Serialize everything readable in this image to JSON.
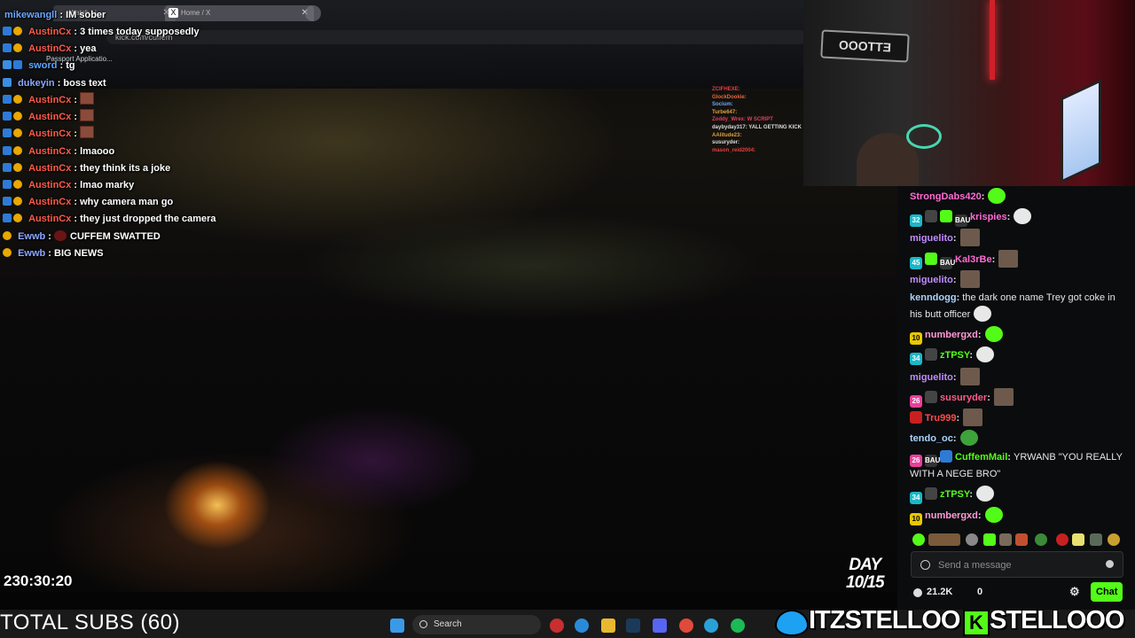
{
  "browser": {
    "tab1_label": "Watch Li",
    "tab2_label": "Home / X",
    "address": "kick.com/cuffem",
    "bookmark": "Passport Applicatio..."
  },
  "overlay_chat": [
    {
      "user": "mikewangll",
      "color": "#6aa8ff",
      "message": "IM sober"
    },
    {
      "user": "AustinCx",
      "color": "#ff5a4a",
      "message": "3 times today supposedly"
    },
    {
      "user": "AustinCx",
      "color": "#ff5a4a",
      "message": "yea"
    },
    {
      "user": "sword",
      "color": "#5aa8ff",
      "message": "tg"
    },
    {
      "user": "dukeyin",
      "color": "#8aa8ff",
      "message": "boss text"
    },
    {
      "user": "AustinCx",
      "color": "#ff5a4a",
      "message": ""
    },
    {
      "user": "AustinCx",
      "color": "#ff5a4a",
      "message": ""
    },
    {
      "user": "AustinCx",
      "color": "#ff5a4a",
      "message": ""
    },
    {
      "user": "AustinCx",
      "color": "#ff5a4a",
      "message": "lmaooo"
    },
    {
      "user": "AustinCx",
      "color": "#ff5a4a",
      "message": "they think its a joke"
    },
    {
      "user": "AustinCx",
      "color": "#ff5a4a",
      "message": "lmao marky"
    },
    {
      "user": "AustinCx",
      "color": "#ff5a4a",
      "message": "why camera man go"
    },
    {
      "user": "AustinCx",
      "color": "#ff5a4a",
      "message": "they just dropped the camera"
    },
    {
      "user": "Ewwb",
      "color": "#8aa8ff",
      "message": "CUFFEM SWATTED"
    },
    {
      "user": "Ewwb",
      "color": "#8aa8ff",
      "message": "BIG NEWS"
    }
  ],
  "mini_chat": [
    "ZCIFHEXE:",
    "GlockDookie:",
    "Socium:",
    "Turbe647:",
    "Zoddy_Wrex: W SCRIPT",
    "daybyday317: YALL GETTING KICK",
    "AAlitude23:",
    "susuryder:",
    "mason_reid2004:"
  ],
  "stream_timer": "230:30:20",
  "day_counter": {
    "line1": "DAY",
    "line2": "10/15"
  },
  "chat": {
    "messages": [
      {
        "user": "StrongDabs420",
        "color": "#ff6ad5",
        "badges": [],
        "text": "",
        "emote": "green"
      },
      {
        "user": "krispies",
        "color": "#ff6ad5",
        "badges": [
          "32",
          "",
          "",
          "BAU"
        ],
        "text": "",
        "emote": "white"
      },
      {
        "user": "miguelito",
        "color": "#c08bff",
        "badges": [],
        "text": "",
        "emote": "avatar"
      },
      {
        "user": "Kal3rBe",
        "color": "#ff6ad5",
        "badges": [
          "45",
          "",
          "BAU"
        ],
        "text": "",
        "emote": "avatar"
      },
      {
        "user": "miguelito",
        "color": "#c08bff",
        "badges": [],
        "text": "",
        "emote": "avatar"
      },
      {
        "user": "kenndogg",
        "color": "#a8d4ff",
        "badges": [],
        "text": "the dark one name Trey got coke in his butt officer",
        "emote": "white"
      },
      {
        "user": "numbergxd",
        "color": "#ff9ad5",
        "badges": [
          "10"
        ],
        "text": "",
        "emote": "green"
      },
      {
        "user": "zTPSY",
        "color": "#53fc18",
        "badges": [
          "34",
          ""
        ],
        "text": "",
        "emote": "white"
      },
      {
        "user": "miguelito",
        "color": "#c08bff",
        "badges": [],
        "text": "",
        "emote": "avatar"
      },
      {
        "user": "susuryder",
        "color": "#ff5a8a",
        "badges": [
          "26",
          ""
        ],
        "text": "",
        "emote": "avatar"
      },
      {
        "user": "Tru999",
        "color": "#ff4a4a",
        "badges": [
          ""
        ],
        "text": "",
        "emote": "avatar"
      },
      {
        "user": "tendo_oc",
        "color": "#a8d4ff",
        "badges": [],
        "text": "",
        "emote": "pepe"
      },
      {
        "user": "CuffemMail",
        "color": "#53fc18",
        "badges": [
          "26",
          "BAU",
          ""
        ],
        "text": "YRWANB \"YOU REALLY WITH A NEGE BRO\"",
        "emote": ""
      },
      {
        "user": "zTPSY",
        "color": "#53fc18",
        "badges": [
          "34",
          ""
        ],
        "text": "",
        "emote": "white"
      },
      {
        "user": "numbergxd",
        "color": "#ff9ad5",
        "badges": [
          "10"
        ],
        "text": "",
        "emote": "green"
      }
    ],
    "input_placeholder": "Send a message",
    "viewer_count": "21.2K",
    "points": "0",
    "chat_button": "Chat"
  },
  "bottom": {
    "subs_label": "TOTAL SUBS (60)",
    "search_label": "Search",
    "twitter_handle": "ITZSTELLOO",
    "kick_handle": "STELLOOO",
    "kick_letter": "K"
  },
  "colors": {
    "kick_green": "#53fc18",
    "chat_bg": "#0b0c0d"
  }
}
